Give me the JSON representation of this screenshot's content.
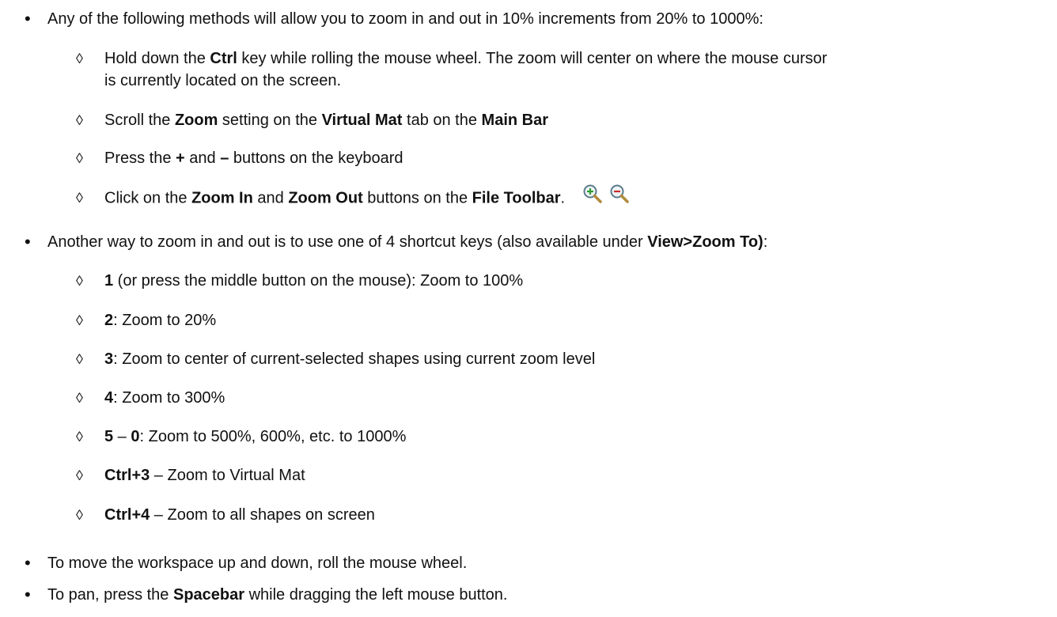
{
  "bullet_symbol": "•",
  "sub_symbol": "◊",
  "zoom_icons": [
    "zoom-in-icon",
    "zoom-out-icon"
  ],
  "section1": {
    "intro": "Any of the following methods will allow you to zoom in and out in 10% increments from 20% to 1000%:",
    "m1": {
      "a": "Hold down the ",
      "b": "Ctrl",
      "c": " key while rolling the mouse wheel. The zoom will center on where the mouse cursor",
      "d": "is currently located on the screen."
    },
    "m2": {
      "a": "Scroll the ",
      "b": "Zoom",
      "c": " setting on the ",
      "d": "Virtual Mat",
      "e": " tab on the ",
      "f": "Main Bar"
    },
    "m3": {
      "a": "Press the ",
      "b": "+",
      "c": " and ",
      "d": "–",
      "e": " buttons on the keyboard"
    },
    "m4": {
      "a": "Click on the ",
      "b": "Zoom In",
      "c": " and ",
      "d": "Zoom Out",
      "e": " buttons on the ",
      "f": "File Toolbar",
      "g": "."
    }
  },
  "section2": {
    "intro_a": "Another way to zoom in and out is to use one of 4 shortcut keys (also available under ",
    "intro_b": "View>Zoom To)",
    "intro_c": ":",
    "k1": {
      "key": "1",
      "text": " (or press the middle button on the mouse): Zoom to 100%"
    },
    "k2": {
      "key": "2",
      "text": ": Zoom to 20%"
    },
    "k3": {
      "key": "3",
      "text": ": Zoom to center of current-selected shapes using current zoom level"
    },
    "k4": {
      "key": "4",
      "text": ": Zoom to 300%"
    },
    "k5": {
      "key_a": "5",
      "sep": " – ",
      "key_b": "0",
      "text": ": Zoom to 500%, 600%, etc. to 1000%"
    },
    "k6": {
      "key": "Ctrl+3",
      "text": " – Zoom to Virtual Mat"
    },
    "k7": {
      "key": "Ctrl+4",
      "text": " – Zoom to all shapes on screen"
    }
  },
  "section3": {
    "move": "To move the workspace up and down, roll the mouse wheel.",
    "pan_a": "To pan, press the ",
    "pan_b": "Spacebar",
    "pan_c": " while dragging the left mouse button."
  }
}
